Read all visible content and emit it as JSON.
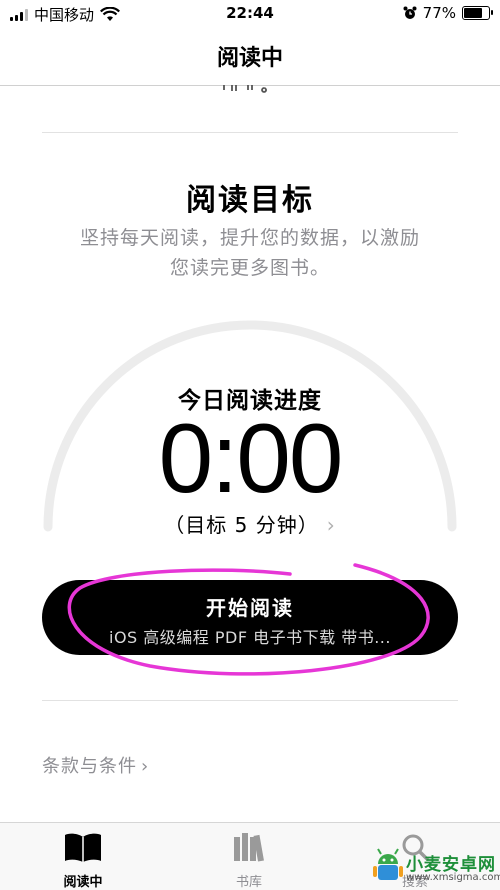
{
  "status_bar": {
    "carrier": "中国移动",
    "time": "22:44",
    "battery_percent": "77%",
    "battery_level": 0.77
  },
  "nav": {
    "title": "阅读中"
  },
  "goal": {
    "title": "阅读目标",
    "description_line1": "坚持每天阅读，提升您的数据，以激励",
    "description_line2": "您读完更多图书。",
    "progress_label": "今日阅读进度",
    "time_value": "0:00",
    "goal_text": "（目标 5 分钟）",
    "progress_fraction": 0
  },
  "start_button": {
    "label": "开始阅读",
    "book_title": "iOS 高级编程 PDF 电子书下载 带书..."
  },
  "terms": {
    "label": "条款与条件"
  },
  "tabbar": {
    "tabs": [
      {
        "label": "阅读中",
        "active": true
      },
      {
        "label": "书库",
        "active": false
      },
      {
        "label": "搜索",
        "active": false
      }
    ]
  },
  "watermark": {
    "title": "小麦安卓网",
    "url": "www.xmsigma.com"
  },
  "colors": {
    "annotation": "#e636d6",
    "accent_text": "#000000",
    "secondary_text": "#8e8e93",
    "ring": "#ececec"
  }
}
